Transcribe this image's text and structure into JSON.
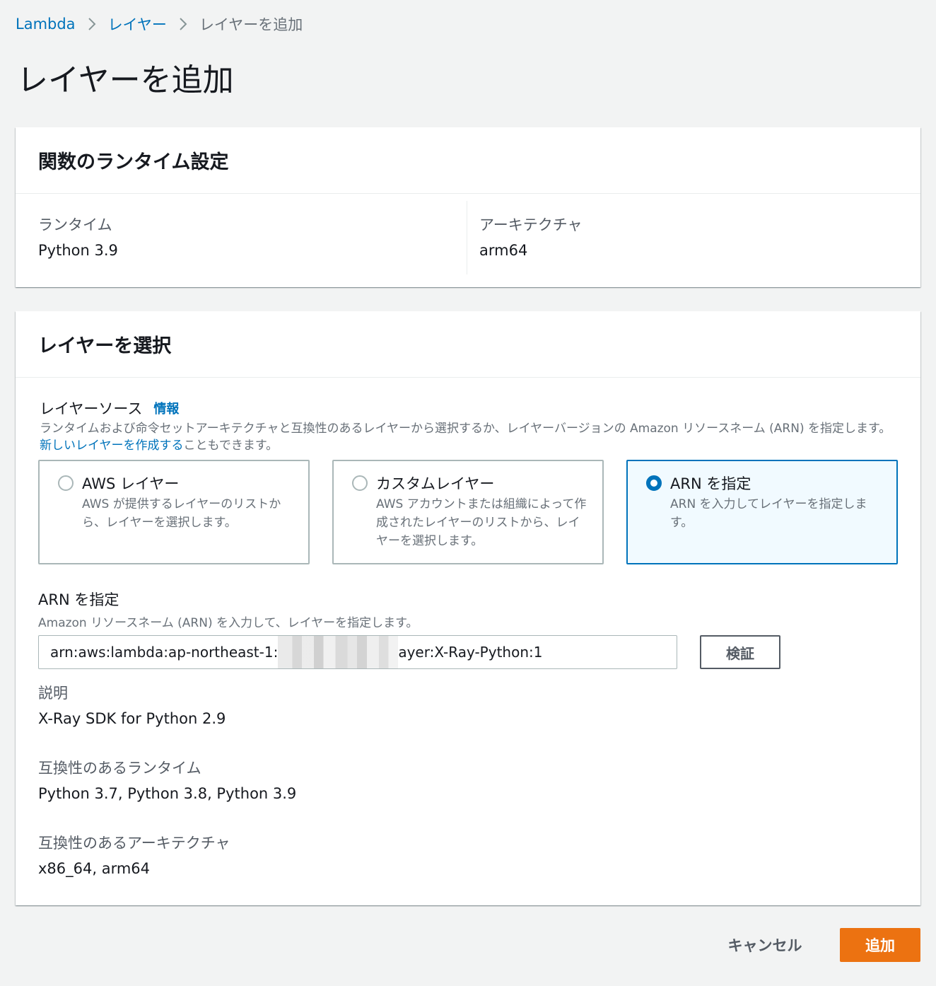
{
  "breadcrumb": {
    "items": [
      {
        "label": "Lambda"
      },
      {
        "label": "レイヤー"
      },
      {
        "label": "レイヤーを追加"
      }
    ]
  },
  "page": {
    "title": "レイヤーを追加"
  },
  "runtime_settings": {
    "title": "関数のランタイム設定",
    "runtime_label": "ランタイム",
    "runtime_value": "Python 3.9",
    "architecture_label": "アーキテクチャ",
    "architecture_value": "arm64"
  },
  "layer_select": {
    "title": "レイヤーを選択",
    "source_label": "レイヤーソース",
    "info_link": "情報",
    "source_description_before": "ランタイムおよび命令セットアーキテクチャと互換性のあるレイヤーから選択するか、レイヤーバージョンの Amazon リソースネーム (ARN) を指定します。",
    "source_description_link": "新しいレイヤーを作成する",
    "source_description_after": "こともできます。",
    "options": [
      {
        "title": "AWS レイヤー",
        "description": "AWS が提供するレイヤーのリストから、レイヤーを選択します。",
        "selected": false
      },
      {
        "title": "カスタムレイヤー",
        "description": "AWS アカウントまたは組織によって作成されたレイヤーのリストから、レイヤーを選択します。",
        "selected": false
      },
      {
        "title": "ARN を指定",
        "description": "ARN を入力してレイヤーを指定します。",
        "selected": true
      }
    ],
    "arn_label": "ARN を指定",
    "arn_description": "Amazon リソースネーム (ARN) を入力して、レイヤーを指定します。",
    "arn_value_prefix": "arn:aws:lambda:ap-northeast-1:",
    "arn_value_suffix": "ayer:X-Ray-Python:1",
    "validate_label": "検証",
    "description_label": "説明",
    "description_value": "X-Ray SDK for Python 2.9",
    "compatible_runtimes_label": "互換性のあるランタイム",
    "compatible_runtimes_value": "Python 3.7, Python 3.8, Python 3.9",
    "compatible_architectures_label": "互換性のあるアーキテクチャ",
    "compatible_architectures_value": "x86_64, arm64"
  },
  "footer": {
    "cancel_label": "キャンセル",
    "add_label": "追加"
  },
  "colors": {
    "link": "#0073bb",
    "primary": "#ec7211",
    "background": "#f2f3f3",
    "selected_tile_bg": "#f1faff"
  }
}
